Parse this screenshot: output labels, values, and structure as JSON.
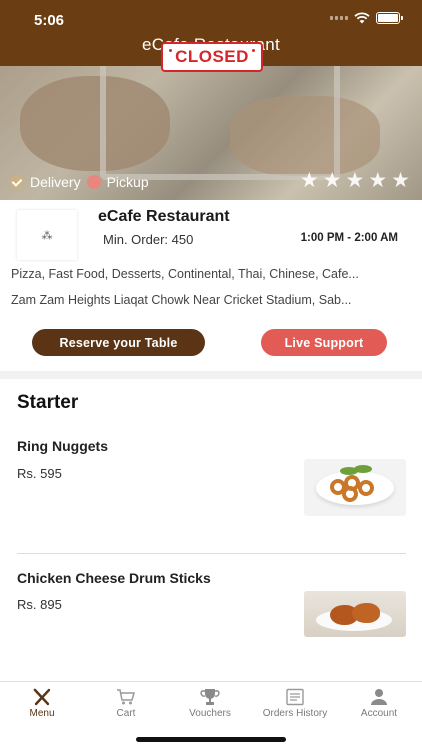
{
  "status_bar": {
    "time": "5:06"
  },
  "header": {
    "title": "eCafe Restaurant"
  },
  "hero": {
    "status_badge": "CLOSED",
    "delivery_label": "Delivery",
    "pickup_label": "Pickup",
    "rating_stars": 5
  },
  "restaurant": {
    "name": "eCafe Restaurant",
    "min_order": "Min. Order: 450",
    "hours": "1:00 PM - 2:00 AM",
    "cuisines": "Pizza, Fast Food, Desserts, Continental, Thai, Chinese, Cafe...",
    "address": "Zam Zam Heights Liaqat Chowk Near Cricket Stadium, Sab..."
  },
  "actions": {
    "reserve_label": "Reserve your Table",
    "support_label": "Live Support"
  },
  "menu": {
    "section_title": "Starter",
    "items": [
      {
        "name": "Ring Nuggets",
        "price": "Rs. 595"
      },
      {
        "name": "Chicken Cheese Drum Sticks",
        "price": "Rs. 895"
      }
    ]
  },
  "tabbar": {
    "tabs": [
      {
        "label": "Menu",
        "icon": "fork-knife-icon",
        "active": true
      },
      {
        "label": "Cart",
        "icon": "cart-icon",
        "active": false
      },
      {
        "label": "Vouchers",
        "icon": "trophy-icon",
        "active": false
      },
      {
        "label": "Orders History",
        "icon": "receipt-icon",
        "active": false
      },
      {
        "label": "Account",
        "icon": "user-icon",
        "active": false
      }
    ]
  },
  "colors": {
    "brand_brown": "#6b3d12",
    "button_brown": "#5a3415",
    "support_red": "#e35b55",
    "closed_red": "#d7262b"
  }
}
